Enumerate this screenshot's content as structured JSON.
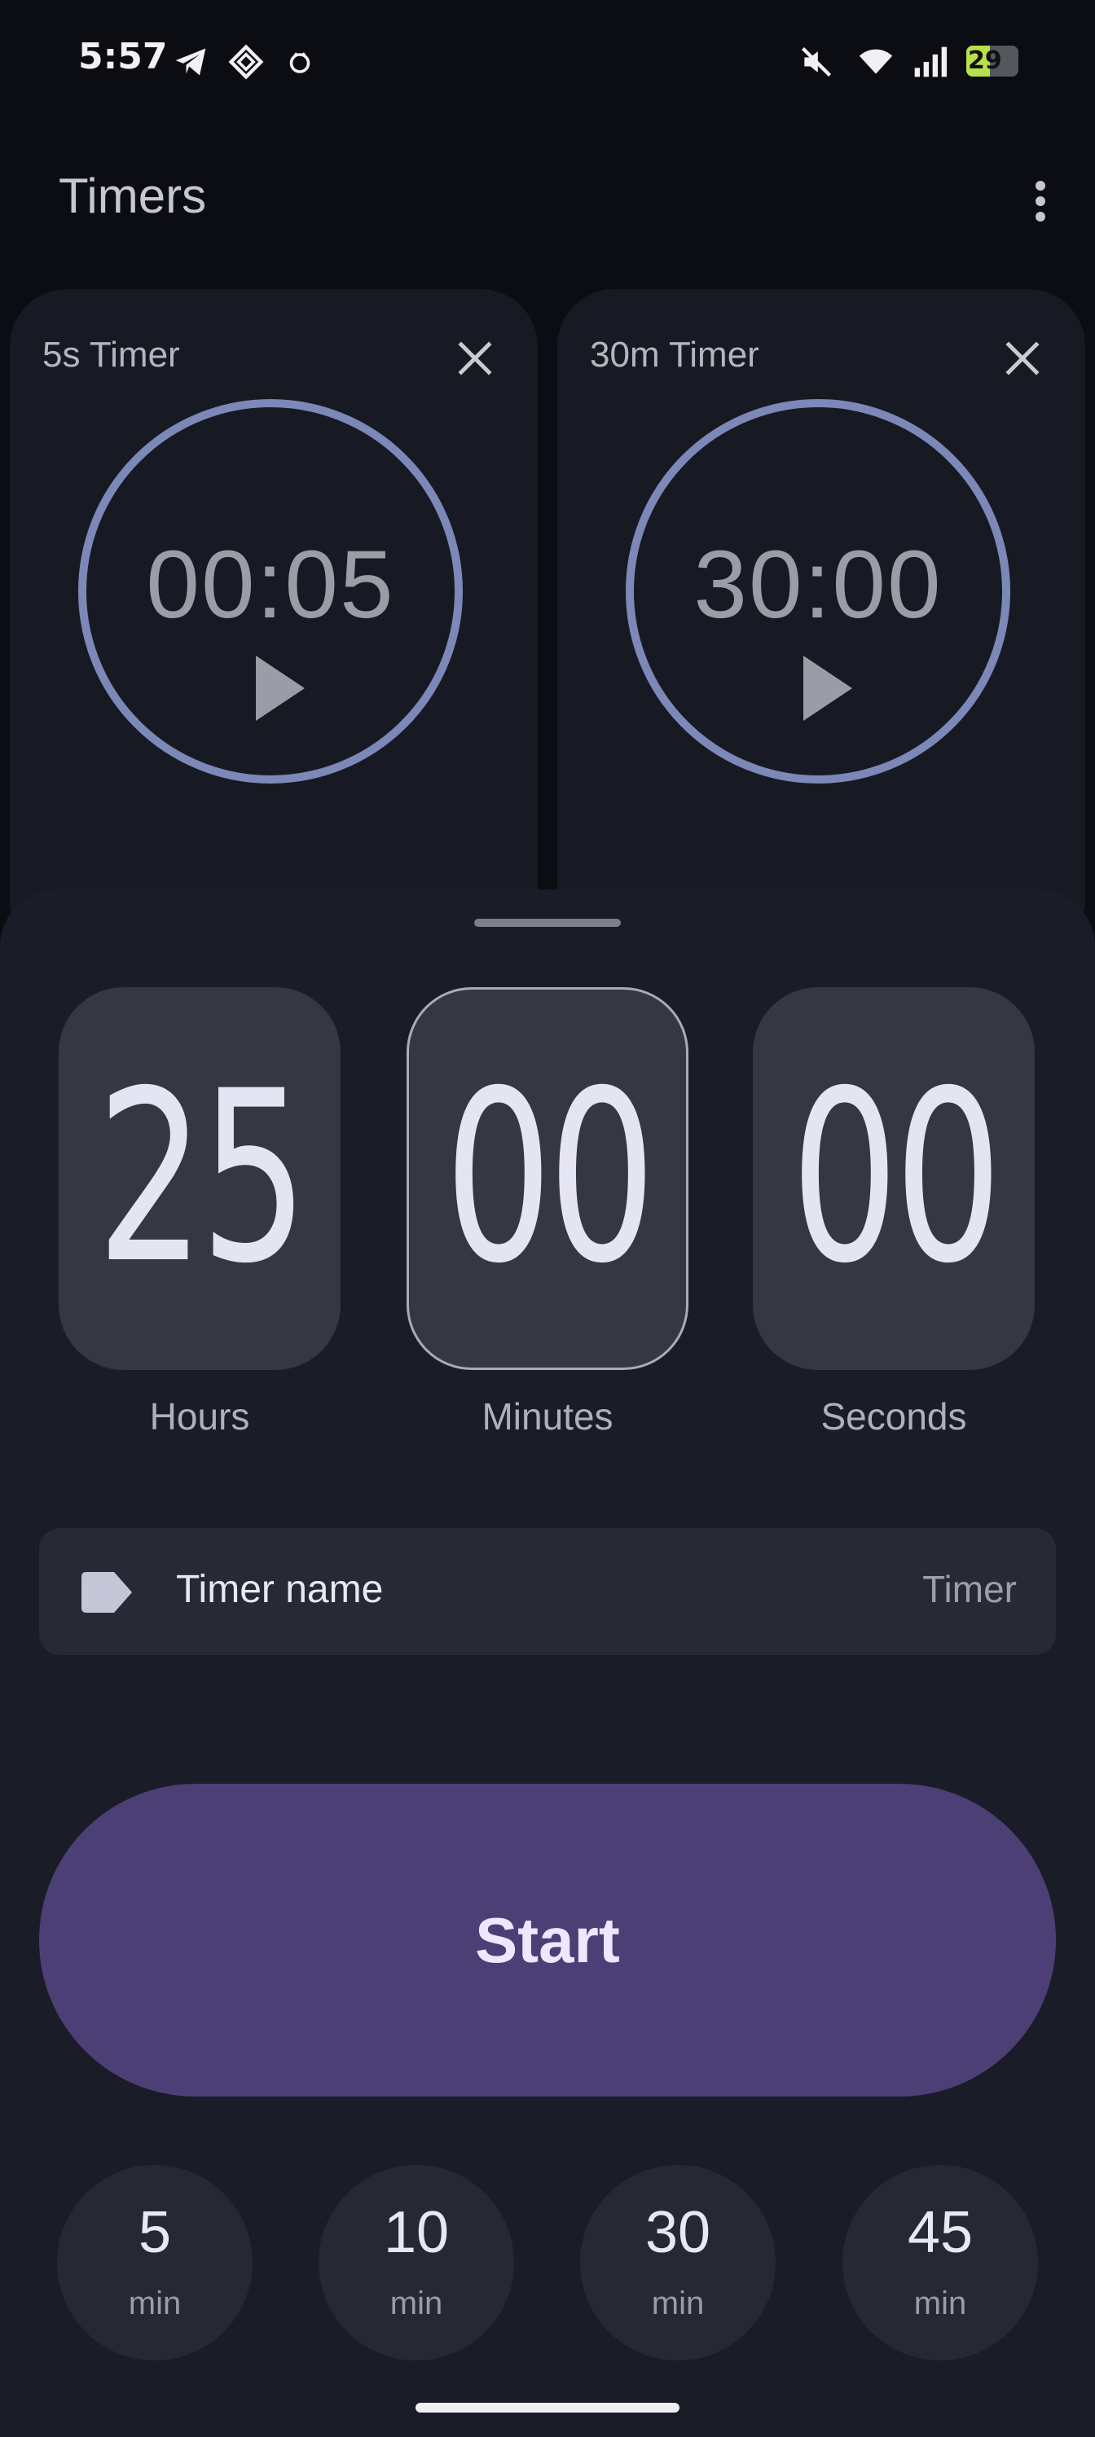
{
  "status_bar": {
    "time": "5:57",
    "left_icons": [
      "telegram-icon",
      "app-diamond-icon",
      "bug-icon"
    ],
    "right_icons": [
      "mute-icon",
      "wifi-icon",
      "signal-icon",
      "battery-icon"
    ],
    "battery_level": "29",
    "battery_color": "#b6e14a"
  },
  "header": {
    "title": "Timers",
    "menu_icon": "more-vert-icon"
  },
  "timers": [
    {
      "label": "5s Timer",
      "time": "00:05"
    },
    {
      "label": "30m Timer",
      "time": "30:00"
    }
  ],
  "picker": {
    "hours": "25",
    "minutes": "00",
    "seconds": "00",
    "hours_label": "Hours",
    "minutes_label": "Minutes",
    "seconds_label": "Seconds",
    "selected": "minutes"
  },
  "name_field": {
    "label": "Timer name",
    "placeholder": "Timer"
  },
  "start_button": {
    "label": "Start"
  },
  "presets": [
    {
      "value": "5",
      "unit": "min"
    },
    {
      "value": "10",
      "unit": "min"
    },
    {
      "value": "30",
      "unit": "min"
    },
    {
      "value": "45",
      "unit": "min"
    }
  ],
  "colors": {
    "accent": "#4c3f76",
    "ring": "#7b88b8",
    "background": "#0c0d12",
    "sheet": "#1a1c27"
  }
}
